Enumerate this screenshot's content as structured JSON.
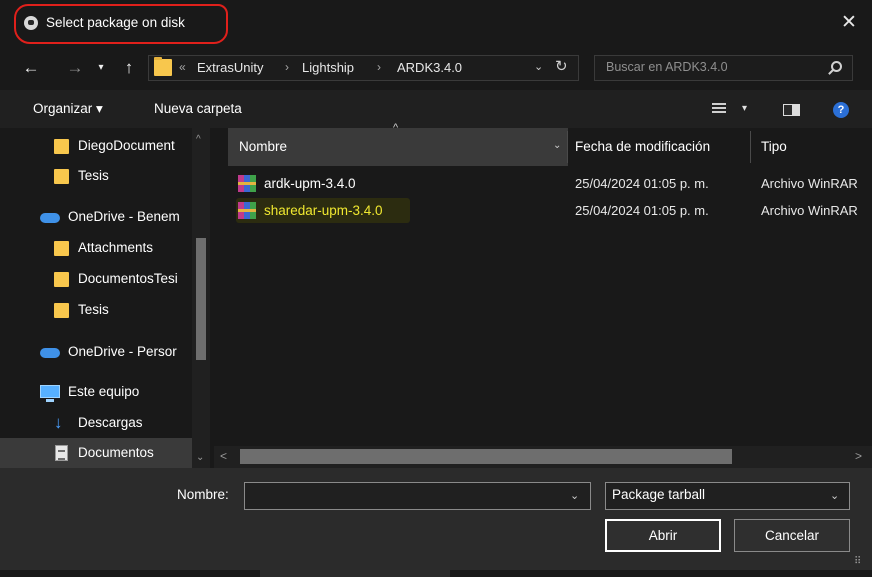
{
  "window": {
    "title": "Select package on disk",
    "close_label": "✕"
  },
  "nav": {
    "back": "←",
    "forward": "→",
    "recent": "▾",
    "up": "↑",
    "overflow": "«",
    "breadcrumb": [
      "ExtrasUnity",
      "Lightship",
      "ARDK3.4.0"
    ],
    "separator": "›",
    "dropdown": "⌄",
    "refresh": "↻",
    "search_placeholder": "Buscar en ARDK3.4.0"
  },
  "toolbar": {
    "organize_label": "Organizar ▾",
    "new_folder_label": "Nueva carpeta",
    "view_dropdown": "▾",
    "help": "?"
  },
  "sidebar": {
    "items": [
      {
        "label": "DiegoDocument",
        "icon": "folder-icon"
      },
      {
        "label": "Tesis",
        "icon": "folder-icon"
      },
      {
        "label": "OneDrive - Benem",
        "icon": "onedrive-cloud-icon"
      },
      {
        "label": "Attachments",
        "icon": "folder-icon"
      },
      {
        "label": "DocumentosTesi",
        "icon": "folder-icon"
      },
      {
        "label": "Tesis",
        "icon": "folder-icon"
      },
      {
        "label": "OneDrive - Persor",
        "icon": "onedrive-cloud-icon"
      },
      {
        "label": "Este equipo",
        "icon": "computer-icon"
      },
      {
        "label": "Descargas",
        "icon": "download-icon"
      },
      {
        "label": "Documentos",
        "icon": "documents-icon"
      }
    ],
    "selected": "Documentos",
    "scroll_up": "^",
    "scroll_down": "⌄"
  },
  "filelist": {
    "columns": {
      "name": "Nombre",
      "date": "Fecha de modificación",
      "type": "Tipo"
    },
    "sort_arrow": "^",
    "name_dropdown": "⌄",
    "rows": [
      {
        "name": "ardk-upm-3.4.0",
        "date": "25/04/2024 01:05 p. m.",
        "type": "Archivo WinRAR",
        "icon": "winrar-archive-icon"
      },
      {
        "name": "sharedar-upm-3.4.0",
        "date": "25/04/2024 01:05 p. m.",
        "type": "Archivo WinRAR",
        "icon": "winrar-archive-icon"
      }
    ],
    "highlighted_row": "sharedar-upm-3.4.0",
    "hscroll_left": "<",
    "hscroll_right": ">"
  },
  "footer": {
    "name_label": "Nombre:",
    "name_value": "",
    "name_dropdown": "⌄",
    "type_value": "Package tarball",
    "type_dropdown": "⌄",
    "open_label": "Abrir",
    "cancel_label": "Cancelar",
    "resize_grip": "⠿"
  },
  "colors": {
    "highlight_text": "#f0e830",
    "annotation_red": "#e0201b",
    "folder": "#f8c74d",
    "accent_blue": "#2b6fd6"
  }
}
